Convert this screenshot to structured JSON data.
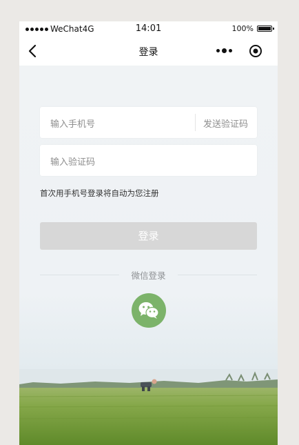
{
  "status_bar": {
    "carrier": "WeChat4G",
    "time": "14:01",
    "battery": "100%",
    "battery_level": 1.0
  },
  "nav": {
    "title": "登录"
  },
  "form": {
    "phone_placeholder": "输入手机号",
    "send_code_label": "发送验证码",
    "code_placeholder": "输入验证码",
    "notice": "首次用手机号登录将自动为您注册",
    "login_label": "登录"
  },
  "wechat": {
    "separator_label": "微信登录",
    "icon": "wechat-icon",
    "color": "#7cb36a"
  },
  "colors": {
    "login_button_disabled": "#d7d7d7",
    "grass": "#7ea43c"
  }
}
